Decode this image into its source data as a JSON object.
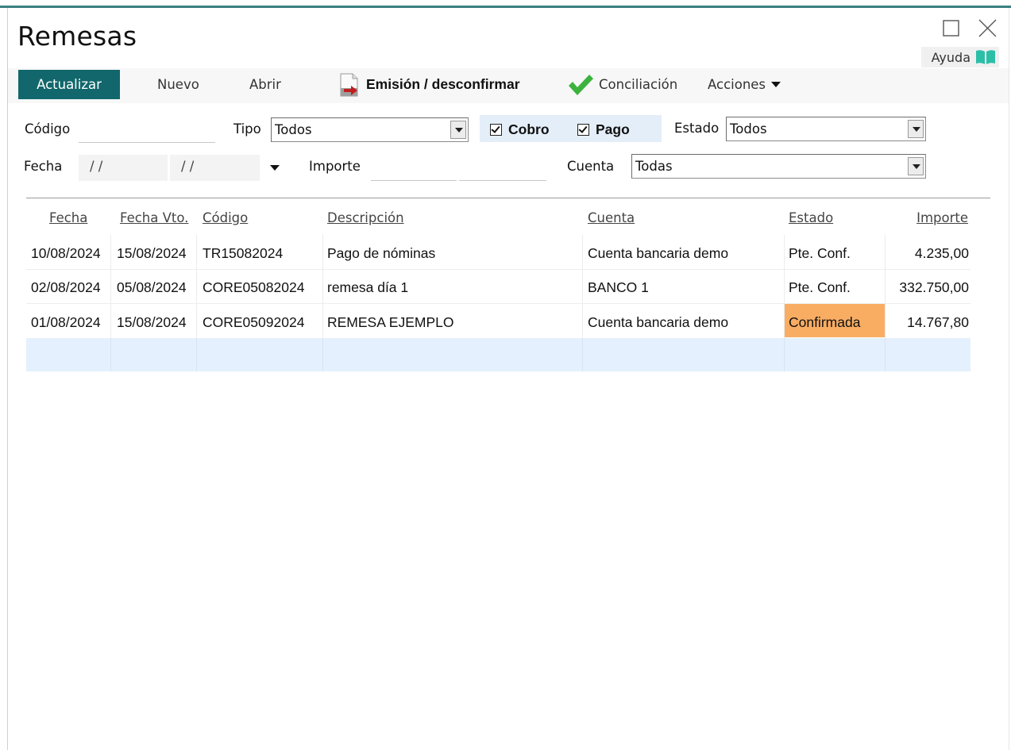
{
  "window": {
    "title": "Remesas",
    "help_label": "Ayuda"
  },
  "toolbar": {
    "actualizar": "Actualizar",
    "nuevo": "Nuevo",
    "abrir": "Abrir",
    "emision": "Emisión / desconfirmar",
    "conciliacion": "Conciliación",
    "acciones": "Acciones"
  },
  "filters": {
    "codigo_label": "Código",
    "codigo_value": "",
    "tipo_label": "Tipo",
    "tipo_value": "Todos",
    "cobro_label": "Cobro",
    "cobro_checked": true,
    "pago_label": "Pago",
    "pago_checked": true,
    "estado_label": "Estado",
    "estado_value": "Todos",
    "fecha_label": "Fecha",
    "fecha_desde": "/ /",
    "fecha_hasta": "/ /",
    "importe_label": "Importe",
    "cuenta_label": "Cuenta",
    "cuenta_value": "Todas"
  },
  "table": {
    "columns": [
      "Fecha",
      "Fecha Vto.",
      "Código",
      "Descripción",
      "Cuenta",
      "Estado",
      "Importe"
    ],
    "rows": [
      {
        "fecha": "10/08/2024",
        "vto": "15/08/2024",
        "codigo": "TR15082024",
        "descripcion": "Pago de nóminas",
        "cuenta": "Cuenta bancaria demo",
        "estado": "Pte. Conf.",
        "importe": "4.235,00"
      },
      {
        "fecha": "02/08/2024",
        "vto": "05/08/2024",
        "codigo": "CORE05082024",
        "descripcion": "remesa día 1",
        "cuenta": "BANCO 1",
        "estado": "Pte. Conf.",
        "importe": "332.750,00"
      },
      {
        "fecha": "01/08/2024",
        "vto": "15/08/2024",
        "codigo": "CORE05092024",
        "descripcion": "REMESA EJEMPLO",
        "cuenta": "Cuenta bancaria demo",
        "estado": "Confirmada",
        "importe": "14.767,80"
      }
    ]
  },
  "colors": {
    "accent": "#11676b",
    "confirmed_bg": "#f9ad63",
    "selected_row_bg": "#e4f0fd",
    "check_green": "#3cb33c",
    "help_icon": "#2bbfa8"
  }
}
